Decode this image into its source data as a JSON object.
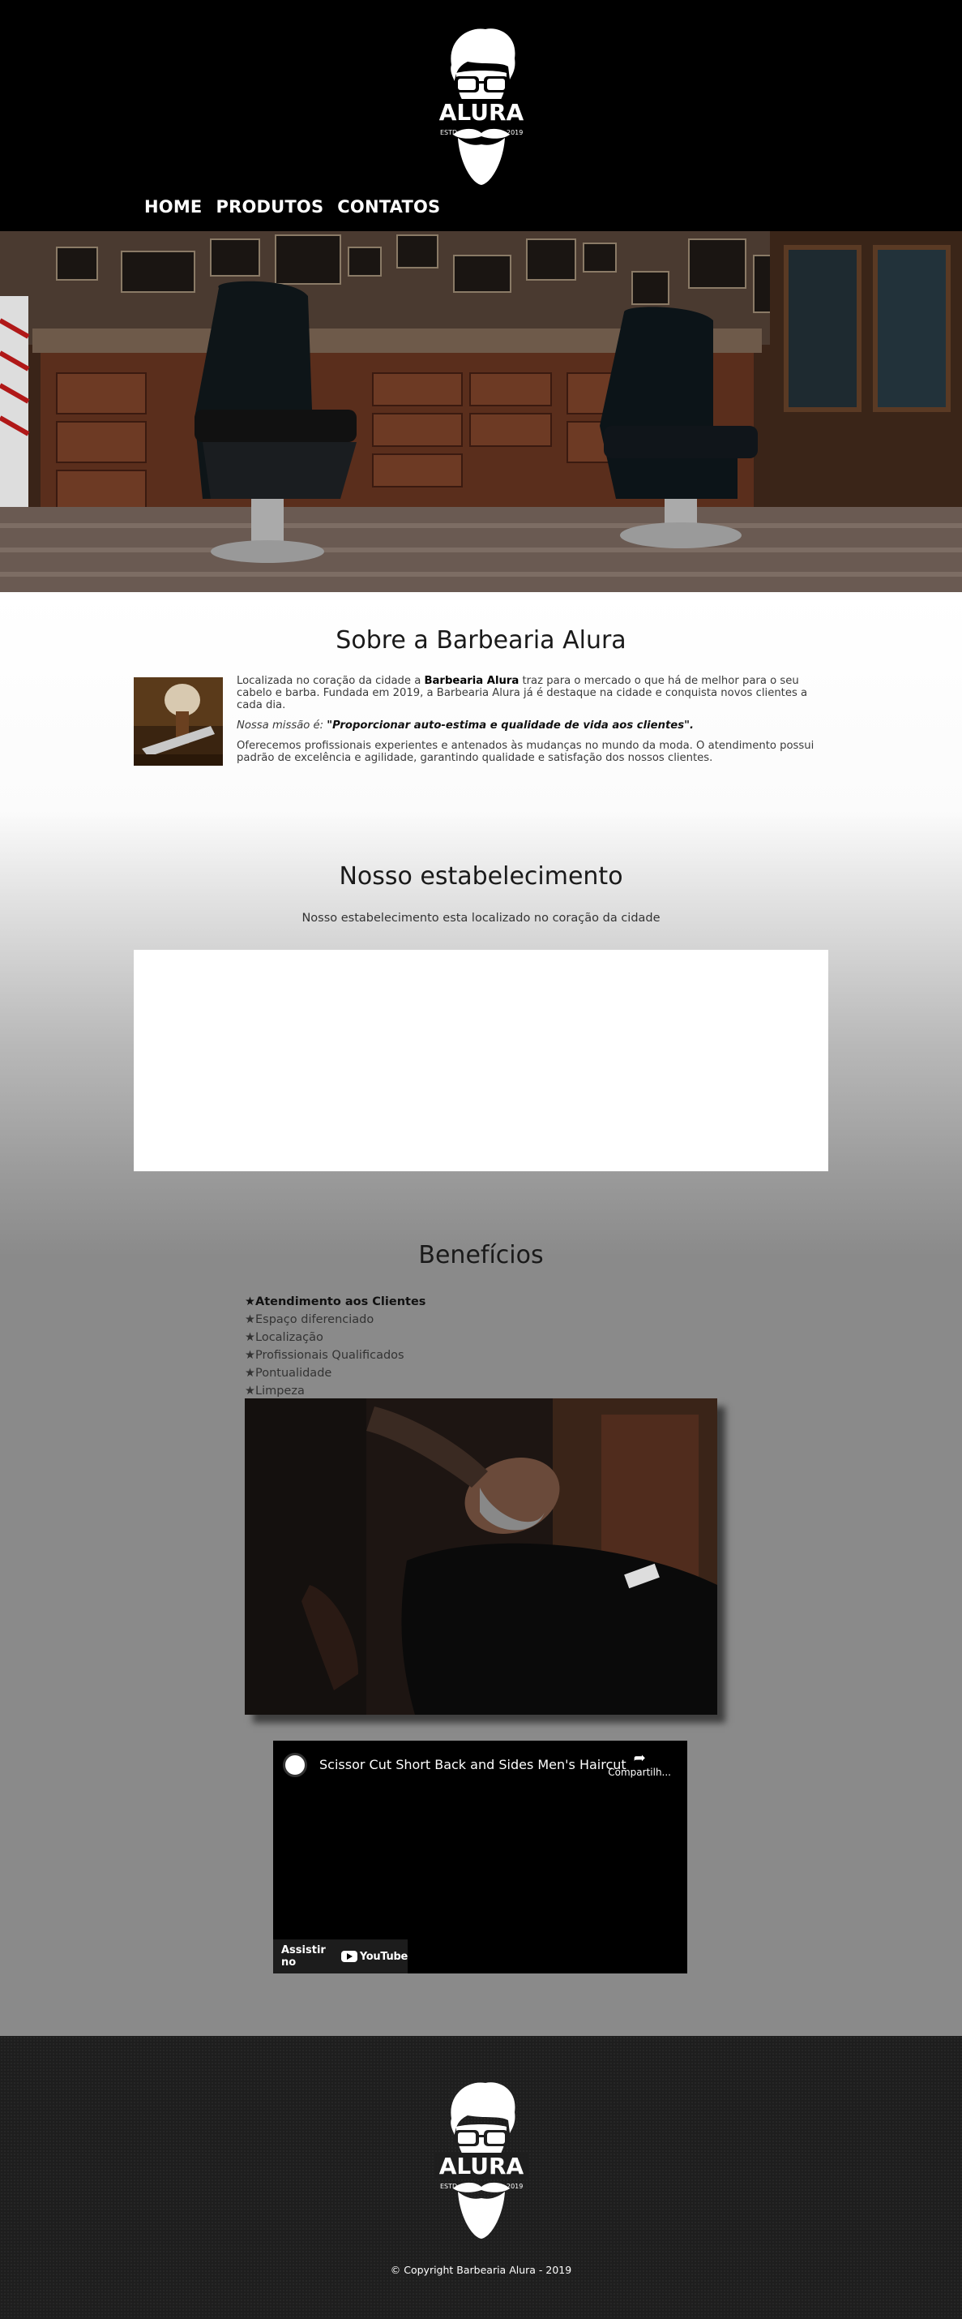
{
  "brand": {
    "name": "ALURA",
    "est_label": "ESTD",
    "year": "2019"
  },
  "nav": {
    "items": [
      {
        "label": "HOME"
      },
      {
        "label": "PRODUTOS"
      },
      {
        "label": "CONTATOS"
      }
    ]
  },
  "about": {
    "title": "Sobre a Barbearia Alura",
    "p1_before": "Localizada no coração da cidade a ",
    "p1_bold": "Barbearia Alura",
    "p1_after": " traz para o mercado o que há de melhor para o seu cabelo e barba. Fundada em 2019, a Barbearia Alura já é destaque na cidade e conquista novos clientes a cada dia.",
    "mission_label": "Nossa missão é: ",
    "mission_quote": "\"Proporcionar auto-estima e qualidade de vida aos clientes\".",
    "p3": "Oferecemos profissionais experientes e antenados às mudanças no mundo da moda. O atendimento possui padrão de excelência e agilidade, garantindo qualidade e satisfação dos nossos clientes."
  },
  "establishment": {
    "title": "Nosso estabelecimento",
    "subtitle": "Nosso estabelecimento esta localizado no coração da cidade"
  },
  "benefits": {
    "title": "Benefícios",
    "items": [
      "★Atendimento aos Clientes",
      "★Espaço diferenciado",
      "★Localização",
      "★Profissionais Qualificados",
      "★Pontualidade",
      "★Limpeza"
    ]
  },
  "video": {
    "title": "Scissor Cut Short Back and Sides Men's Haircut",
    "share_label": "Compartilh...",
    "watch_label": "Assistir no",
    "youtube_label": "YouTube"
  },
  "footer": {
    "copyright": "© Copyright Barbearia Alura - 2019"
  }
}
